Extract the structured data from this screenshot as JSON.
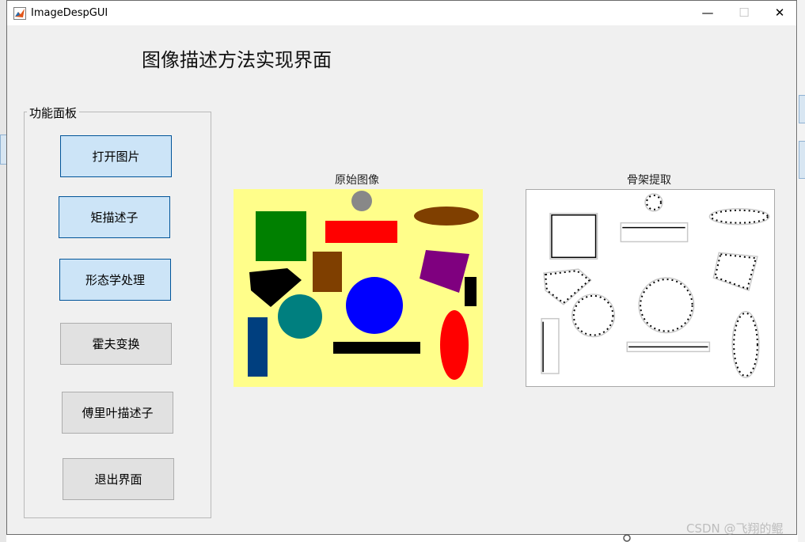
{
  "window": {
    "title": "ImageDespGUI",
    "controls": {
      "minimize": "—",
      "maximize": "☐",
      "close": "✕"
    }
  },
  "main_title": "图像描述方法实现界面",
  "panel": {
    "title": "功能面板",
    "buttons": [
      {
        "label": "打开图片",
        "state": "highlighted"
      },
      {
        "label": "矩描述子",
        "state": "highlighted"
      },
      {
        "label": "形态学处理",
        "state": "highlighted"
      },
      {
        "label": "霍夫变换",
        "state": "normal"
      },
      {
        "label": "傅里叶描述子",
        "state": "normal"
      },
      {
        "label": "退出界面",
        "state": "normal"
      }
    ]
  },
  "axes": {
    "original_label": "原始图像",
    "skeleton_label": "骨架提取"
  },
  "watermark": "CSDN @飞翔的鲲",
  "colors": {
    "image_background": "#fffe8a",
    "button_highlight": "#cce4f7",
    "button_highlight_border": "#005499"
  }
}
